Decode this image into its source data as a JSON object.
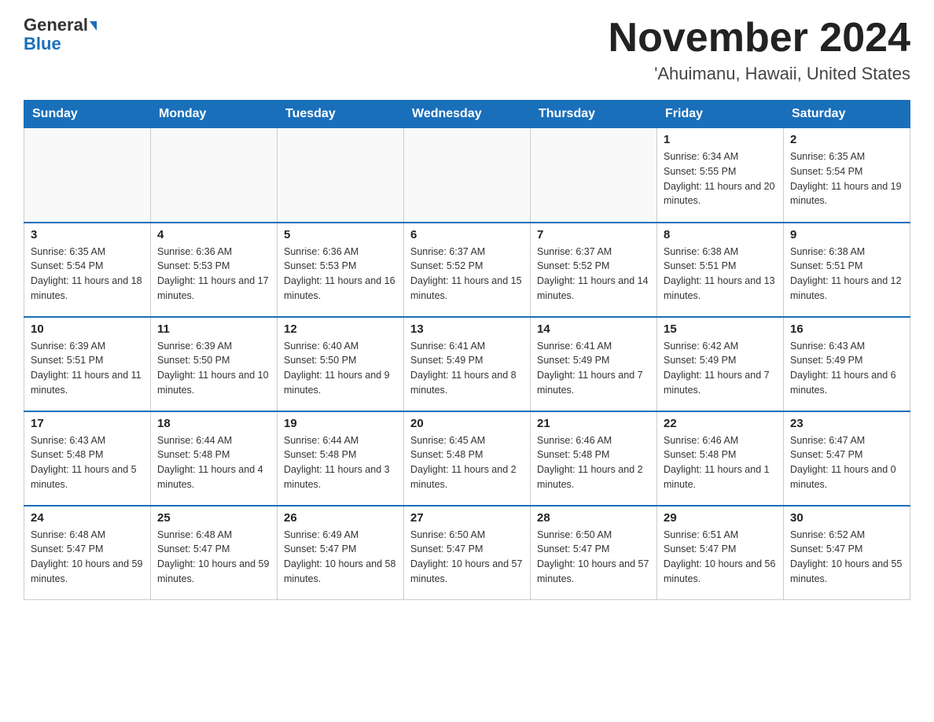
{
  "header": {
    "logo_general": "General",
    "logo_blue": "Blue",
    "month_title": "November 2024",
    "location": "'Ahuimanu, Hawaii, United States"
  },
  "weekdays": [
    "Sunday",
    "Monday",
    "Tuesday",
    "Wednesday",
    "Thursday",
    "Friday",
    "Saturday"
  ],
  "weeks": [
    [
      {
        "day": "",
        "info": ""
      },
      {
        "day": "",
        "info": ""
      },
      {
        "day": "",
        "info": ""
      },
      {
        "day": "",
        "info": ""
      },
      {
        "day": "",
        "info": ""
      },
      {
        "day": "1",
        "info": "Sunrise: 6:34 AM\nSunset: 5:55 PM\nDaylight: 11 hours and 20 minutes."
      },
      {
        "day": "2",
        "info": "Sunrise: 6:35 AM\nSunset: 5:54 PM\nDaylight: 11 hours and 19 minutes."
      }
    ],
    [
      {
        "day": "3",
        "info": "Sunrise: 6:35 AM\nSunset: 5:54 PM\nDaylight: 11 hours and 18 minutes."
      },
      {
        "day": "4",
        "info": "Sunrise: 6:36 AM\nSunset: 5:53 PM\nDaylight: 11 hours and 17 minutes."
      },
      {
        "day": "5",
        "info": "Sunrise: 6:36 AM\nSunset: 5:53 PM\nDaylight: 11 hours and 16 minutes."
      },
      {
        "day": "6",
        "info": "Sunrise: 6:37 AM\nSunset: 5:52 PM\nDaylight: 11 hours and 15 minutes."
      },
      {
        "day": "7",
        "info": "Sunrise: 6:37 AM\nSunset: 5:52 PM\nDaylight: 11 hours and 14 minutes."
      },
      {
        "day": "8",
        "info": "Sunrise: 6:38 AM\nSunset: 5:51 PM\nDaylight: 11 hours and 13 minutes."
      },
      {
        "day": "9",
        "info": "Sunrise: 6:38 AM\nSunset: 5:51 PM\nDaylight: 11 hours and 12 minutes."
      }
    ],
    [
      {
        "day": "10",
        "info": "Sunrise: 6:39 AM\nSunset: 5:51 PM\nDaylight: 11 hours and 11 minutes."
      },
      {
        "day": "11",
        "info": "Sunrise: 6:39 AM\nSunset: 5:50 PM\nDaylight: 11 hours and 10 minutes."
      },
      {
        "day": "12",
        "info": "Sunrise: 6:40 AM\nSunset: 5:50 PM\nDaylight: 11 hours and 9 minutes."
      },
      {
        "day": "13",
        "info": "Sunrise: 6:41 AM\nSunset: 5:49 PM\nDaylight: 11 hours and 8 minutes."
      },
      {
        "day": "14",
        "info": "Sunrise: 6:41 AM\nSunset: 5:49 PM\nDaylight: 11 hours and 7 minutes."
      },
      {
        "day": "15",
        "info": "Sunrise: 6:42 AM\nSunset: 5:49 PM\nDaylight: 11 hours and 7 minutes."
      },
      {
        "day": "16",
        "info": "Sunrise: 6:43 AM\nSunset: 5:49 PM\nDaylight: 11 hours and 6 minutes."
      }
    ],
    [
      {
        "day": "17",
        "info": "Sunrise: 6:43 AM\nSunset: 5:48 PM\nDaylight: 11 hours and 5 minutes."
      },
      {
        "day": "18",
        "info": "Sunrise: 6:44 AM\nSunset: 5:48 PM\nDaylight: 11 hours and 4 minutes."
      },
      {
        "day": "19",
        "info": "Sunrise: 6:44 AM\nSunset: 5:48 PM\nDaylight: 11 hours and 3 minutes."
      },
      {
        "day": "20",
        "info": "Sunrise: 6:45 AM\nSunset: 5:48 PM\nDaylight: 11 hours and 2 minutes."
      },
      {
        "day": "21",
        "info": "Sunrise: 6:46 AM\nSunset: 5:48 PM\nDaylight: 11 hours and 2 minutes."
      },
      {
        "day": "22",
        "info": "Sunrise: 6:46 AM\nSunset: 5:48 PM\nDaylight: 11 hours and 1 minute."
      },
      {
        "day": "23",
        "info": "Sunrise: 6:47 AM\nSunset: 5:47 PM\nDaylight: 11 hours and 0 minutes."
      }
    ],
    [
      {
        "day": "24",
        "info": "Sunrise: 6:48 AM\nSunset: 5:47 PM\nDaylight: 10 hours and 59 minutes."
      },
      {
        "day": "25",
        "info": "Sunrise: 6:48 AM\nSunset: 5:47 PM\nDaylight: 10 hours and 59 minutes."
      },
      {
        "day": "26",
        "info": "Sunrise: 6:49 AM\nSunset: 5:47 PM\nDaylight: 10 hours and 58 minutes."
      },
      {
        "day": "27",
        "info": "Sunrise: 6:50 AM\nSunset: 5:47 PM\nDaylight: 10 hours and 57 minutes."
      },
      {
        "day": "28",
        "info": "Sunrise: 6:50 AM\nSunset: 5:47 PM\nDaylight: 10 hours and 57 minutes."
      },
      {
        "day": "29",
        "info": "Sunrise: 6:51 AM\nSunset: 5:47 PM\nDaylight: 10 hours and 56 minutes."
      },
      {
        "day": "30",
        "info": "Sunrise: 6:52 AM\nSunset: 5:47 PM\nDaylight: 10 hours and 55 minutes."
      }
    ]
  ]
}
